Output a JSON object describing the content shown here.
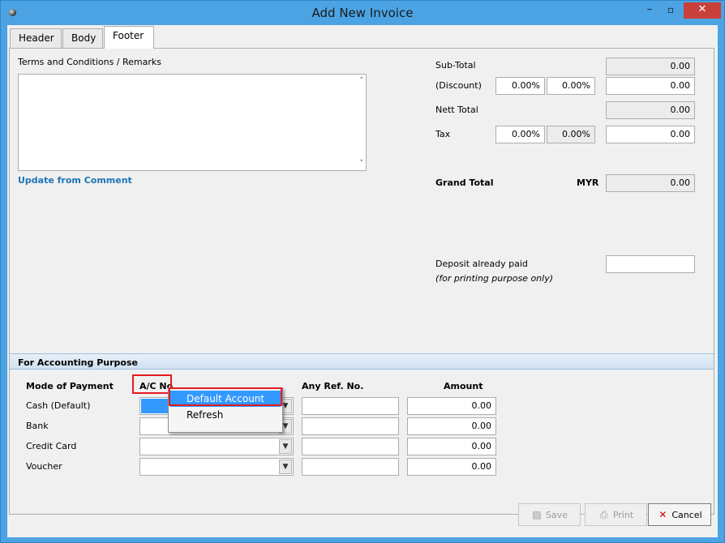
{
  "window": {
    "title": "Add New Invoice",
    "minimize": "–",
    "maximize": "▫",
    "close": "✕"
  },
  "tabs": [
    {
      "label": "Header"
    },
    {
      "label": "Body"
    },
    {
      "label": "Footer"
    }
  ],
  "remarks": {
    "label": "Terms and Conditions / Remarks",
    "scroll_up": "˄",
    "scroll_down": "˅",
    "update_link": "Update from Comment"
  },
  "totals": {
    "subtotal_label": "Sub-Total",
    "subtotal": "0.00",
    "discount_label": "(Discount)",
    "discount_pct1": "0.00%",
    "discount_pct2": "0.00%",
    "discount": "0.00",
    "nett_label": "Nett Total",
    "nett": "0.00",
    "tax_label": "Tax",
    "tax_pct1": "0.00%",
    "tax_pct2": "0.00%",
    "tax": "0.00",
    "grand_label": "Grand Total",
    "currency": "MYR",
    "grand": "0.00",
    "deposit_label": "Deposit already paid",
    "deposit_note": "(for printing purpose only)",
    "deposit": ""
  },
  "accounting": {
    "section_title": "For Accounting Purpose",
    "col_mode": "Mode of Payment",
    "col_ac": "A/C No.",
    "col_ref": "Any Ref. No.",
    "col_amount": "Amount",
    "rows": [
      {
        "mode": "Cash (Default)",
        "ref": "",
        "amount": "0.00"
      },
      {
        "mode": "Bank",
        "ref": "",
        "amount": "0.00"
      },
      {
        "mode": "Credit Card",
        "ref": "",
        "amount": "0.00"
      },
      {
        "mode": "Voucher",
        "ref": "",
        "amount": "0.00"
      }
    ]
  },
  "context_menu": {
    "items": [
      "Default Account",
      "Refresh"
    ]
  },
  "buttons": {
    "save": "Save",
    "print": "Print",
    "cancel": "Cancel"
  }
}
